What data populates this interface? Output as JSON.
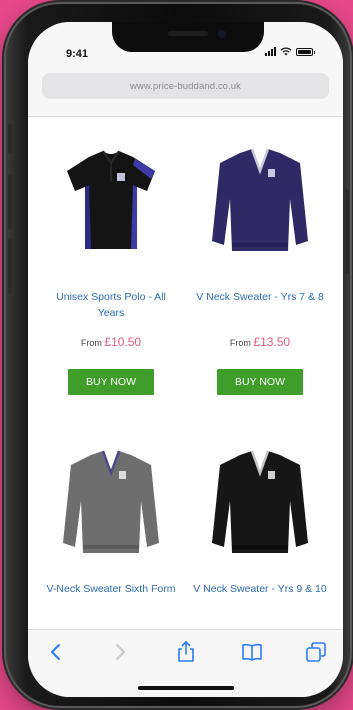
{
  "status_bar": {
    "time": "9:41"
  },
  "browser": {
    "url": "www.price-buddand.co.uk"
  },
  "products": [
    {
      "name": "Unisex Sports Polo - All Years",
      "price_prefix": "From",
      "price": "£10.50",
      "button_label": "BUY NOW",
      "icon": "black-polo-shirt-image"
    },
    {
      "name": "V Neck Sweater - Yrs 7 & 8",
      "price_prefix": "From",
      "price": "£13.50",
      "button_label": "BUY NOW",
      "icon": "purple-v-neck-sweater-image"
    },
    {
      "name": "V-Neck Sweater Sixth Form",
      "icon": "grey-v-neck-sweater-image"
    },
    {
      "name": "V Neck Sweater - Yrs 9 & 10",
      "icon": "black-v-neck-sweater-image"
    }
  ],
  "toolbar": {
    "icons": [
      "back-icon",
      "forward-icon",
      "share-icon",
      "bookmarks-icon",
      "tabs-icon"
    ]
  },
  "colors": {
    "background": "#e8498a",
    "link": "#2d6cb5",
    "price": "#e35a80",
    "buy_button": "#3e9e29",
    "toolbar_icon": "#2a7cf5"
  }
}
